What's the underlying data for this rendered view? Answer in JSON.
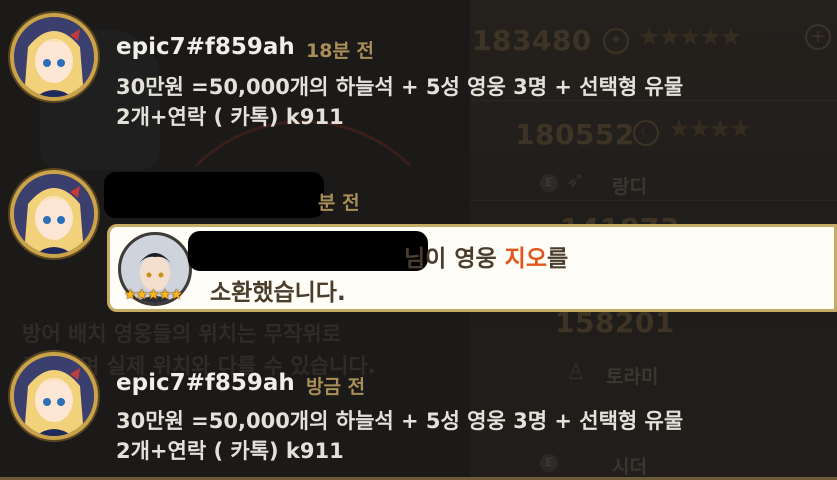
{
  "background": {
    "scores": [
      "183480",
      "180552",
      "141873",
      "158201"
    ],
    "hero_names": [
      "랑디",
      "토라미",
      "시더"
    ],
    "hint_line1": "방어 배치 영웅들의 위치는 무작위로",
    "hint_line2": "표시되며 실제 위치와 다를 수 있습니다.",
    "plus_label": "+",
    "badge_label": "E"
  },
  "messages": [
    {
      "username": "epic7#f859ah",
      "time": "18분 전",
      "text_line1": "30만원 =50,000개의 하늘석 + 5성 영웅 3명 + 선택형 유물",
      "text_line2": "2개+연락 ( 카톡) k911"
    },
    {
      "username": "",
      "time": "분 전",
      "notice": {
        "line1_suffix": "님이 영웅 ",
        "hero": "지오",
        "line1_end": "를",
        "line2": "소환했습니다.",
        "stars": "★★★★★"
      }
    },
    {
      "username": "epic7#f859ah",
      "time": "방금 전",
      "text_line1": "30만원 =50,000개의 하늘석 + 5성 영웅 3명 + 선택형 유물",
      "text_line2": "2개+연락 ( 카톡) k911"
    }
  ],
  "colors": {
    "background": "#1b1a18",
    "highlight": "#e0561b",
    "time_gold": "#a98f57",
    "frame_gold": "#c9a24a",
    "star_gold": "#ffb718"
  }
}
